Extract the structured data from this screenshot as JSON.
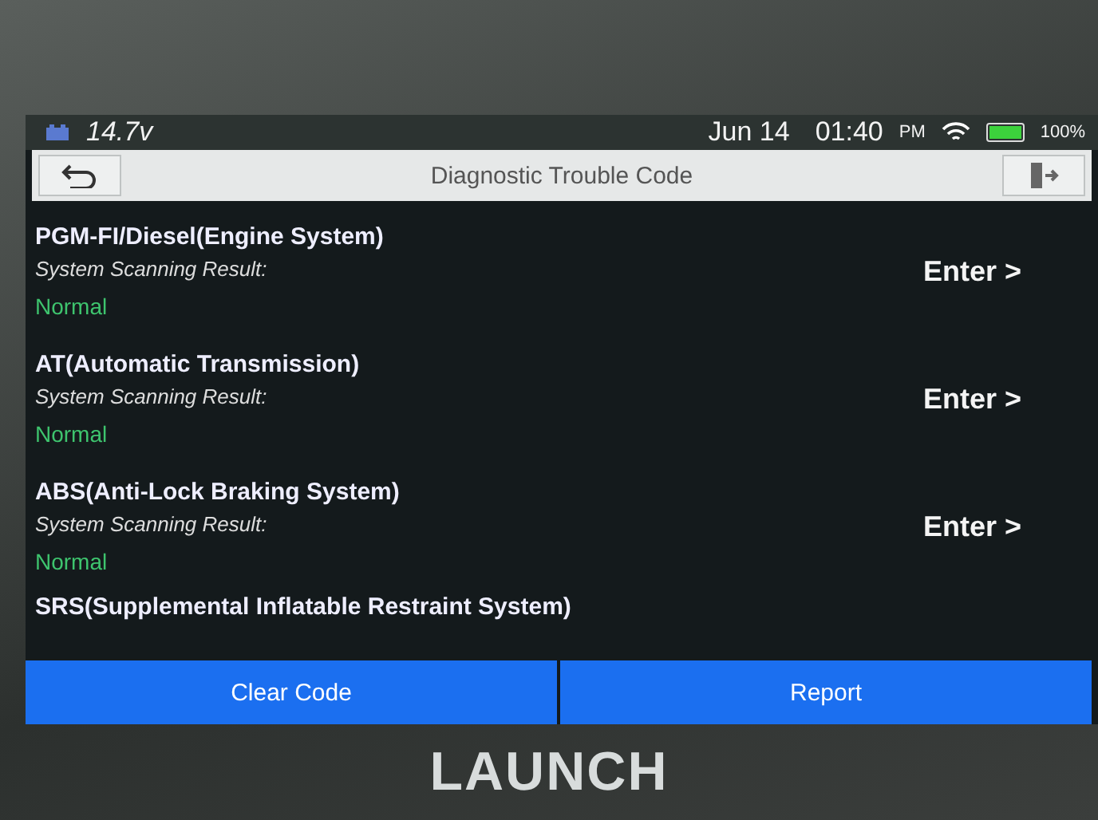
{
  "status_bar": {
    "voltage": "14.7v",
    "date": "Jun 14",
    "time": "01:40",
    "ampm": "PM",
    "battery": "100%"
  },
  "title_bar": {
    "title": "Diagnostic Trouble Code"
  },
  "systems": [
    {
      "name": "PGM-FI/Diesel(Engine System)",
      "label": "System Scanning Result:",
      "result": "Normal",
      "action": "Enter >"
    },
    {
      "name": "AT(Automatic Transmission)",
      "label": "System Scanning Result:",
      "result": "Normal",
      "action": "Enter >"
    },
    {
      "name": "ABS(Anti-Lock Braking System)",
      "label": "System Scanning Result:",
      "result": "Normal",
      "action": "Enter >"
    }
  ],
  "partial_row": "SRS(Supplemental Inflatable Restraint System)",
  "buttons": [
    "Clear Code",
    "Report"
  ],
  "brand": "LAUNCH"
}
